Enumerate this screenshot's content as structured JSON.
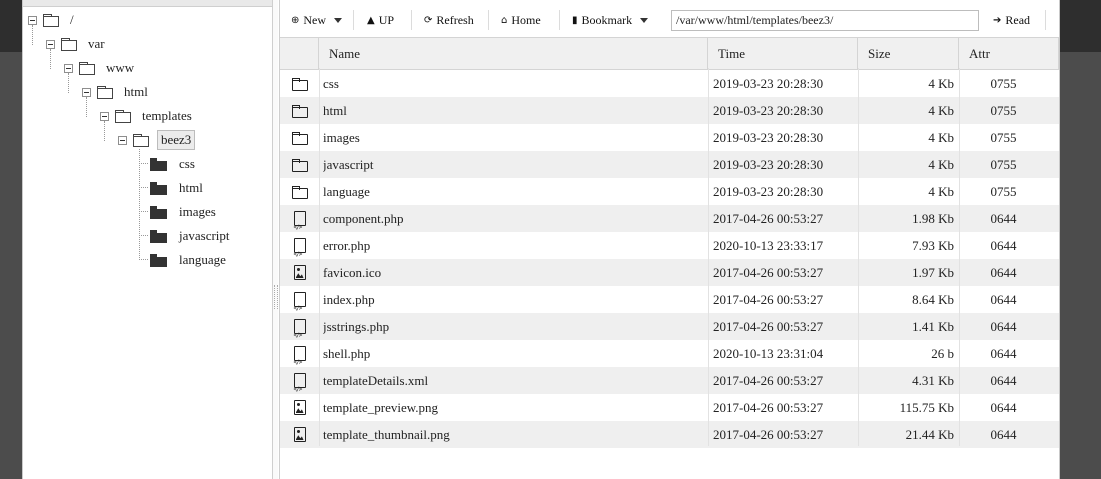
{
  "toolbar": {
    "new_label": "New",
    "up_label": "UP",
    "refresh_label": "Refresh",
    "home_label": "Home",
    "bookmark_label": "Bookmark",
    "path_value": "/var/www/html/templates/beez3/",
    "read_label": "Read"
  },
  "tree": {
    "root": "/",
    "var": "var",
    "www": "www",
    "html": "html",
    "templates": "templates",
    "beez3": "beez3",
    "children": [
      "css",
      "html",
      "images",
      "javascript",
      "language"
    ]
  },
  "columns": {
    "name": "Name",
    "time": "Time",
    "size": "Size",
    "attr": "Attr"
  },
  "files": [
    {
      "icon": "folder-icon",
      "name": "css",
      "time": "2019-03-23 20:28:30",
      "size": "4 Kb",
      "attr": "0755"
    },
    {
      "icon": "folder-icon",
      "name": "html",
      "time": "2019-03-23 20:28:30",
      "size": "4 Kb",
      "attr": "0755"
    },
    {
      "icon": "folder-icon",
      "name": "images",
      "time": "2019-03-23 20:28:30",
      "size": "4 Kb",
      "attr": "0755"
    },
    {
      "icon": "folder-icon",
      "name": "javascript",
      "time": "2019-03-23 20:28:30",
      "size": "4 Kb",
      "attr": "0755"
    },
    {
      "icon": "folder-icon",
      "name": "language",
      "time": "2019-03-23 20:28:30",
      "size": "4 Kb",
      "attr": "0755"
    },
    {
      "icon": "code-file-icon",
      "name": "component.php",
      "time": "2017-04-26 00:53:27",
      "size": "1.98 Kb",
      "attr": "0644"
    },
    {
      "icon": "code-file-icon",
      "name": "error.php",
      "time": "2020-10-13 23:33:17",
      "size": "7.93 Kb",
      "attr": "0644"
    },
    {
      "icon": "image-file-icon",
      "name": "favicon.ico",
      "time": "2017-04-26 00:53:27",
      "size": "1.97 Kb",
      "attr": "0644"
    },
    {
      "icon": "code-file-icon",
      "name": "index.php",
      "time": "2017-04-26 00:53:27",
      "size": "8.64 Kb",
      "attr": "0644"
    },
    {
      "icon": "code-file-icon",
      "name": "jsstrings.php",
      "time": "2017-04-26 00:53:27",
      "size": "1.41 Kb",
      "attr": "0644"
    },
    {
      "icon": "code-file-icon",
      "name": "shell.php",
      "time": "2020-10-13 23:31:04",
      "size": "26 b",
      "attr": "0644"
    },
    {
      "icon": "code-file-icon",
      "name": "templateDetails.xml",
      "time": "2017-04-26 00:53:27",
      "size": "4.31 Kb",
      "attr": "0644"
    },
    {
      "icon": "image-file-icon",
      "name": "template_preview.png",
      "time": "2017-04-26 00:53:27",
      "size": "115.75 Kb",
      "attr": "0644"
    },
    {
      "icon": "image-file-icon",
      "name": "template_thumbnail.png",
      "time": "2017-04-26 00:53:27",
      "size": "21.44 Kb",
      "attr": "0644"
    }
  ]
}
